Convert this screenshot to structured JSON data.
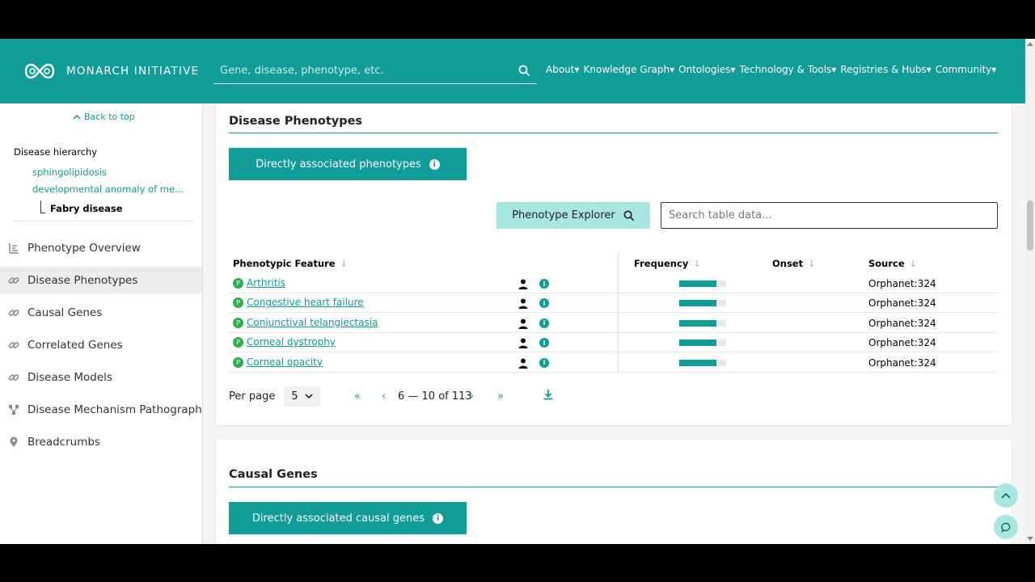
{
  "header": {
    "brand": "MONARCH INITIATIVE",
    "search_placeholder": "Gene, disease, phenotype, etc.",
    "nav": [
      "About▾",
      "Knowledge Graph▾",
      "Ontologies▾",
      "Technology & Tools▾",
      "Registries & Hubs▾",
      "Community▾"
    ]
  },
  "sidebar": {
    "back_to_top": "Back to top",
    "hierarchy_title": "Disease hierarchy",
    "hierarchy_links": [
      "sphingolipidosis",
      "developmental anomaly of me..."
    ],
    "hierarchy_current": "Fabry disease",
    "items": [
      {
        "label": "Phenotype Overview",
        "icon": "chart-icon"
      },
      {
        "label": "Disease Phenotypes",
        "icon": "link-icon"
      },
      {
        "label": "Causal Genes",
        "icon": "link-icon"
      },
      {
        "label": "Correlated Genes",
        "icon": "link-icon"
      },
      {
        "label": "Disease Models",
        "icon": "link-icon"
      },
      {
        "label": "Disease Mechanism Pathograph",
        "icon": "graph-icon"
      },
      {
        "label": "Breadcrumbs",
        "icon": "pin-icon"
      }
    ],
    "active_index": 1
  },
  "phenotypes": {
    "title": "Disease Phenotypes",
    "tab_label": "Directly associated phenotypes",
    "explorer_label": "Phenotype Explorer",
    "table_search_placeholder": "Search table data...",
    "columns": [
      "Phenotypic Feature",
      "Frequency",
      "Onset",
      "Source"
    ],
    "rows": [
      {
        "feature": "Arthritis",
        "frequency": 0.8,
        "source": "Orphanet:324"
      },
      {
        "feature": "Congestive heart failure",
        "frequency": 0.8,
        "source": "Orphanet:324"
      },
      {
        "feature": "Conjunctival telangiectasia",
        "frequency": 0.8,
        "source": "Orphanet:324"
      },
      {
        "feature": "Corneal dystrophy",
        "frequency": 0.8,
        "source": "Orphanet:324"
      },
      {
        "feature": "Corneal opacity",
        "frequency": 0.8,
        "source": "Orphanet:324"
      }
    ],
    "per_page_label": "Per page",
    "per_page_value": "5",
    "range": "6 — 10 of 113"
  },
  "causal": {
    "title": "Causal Genes",
    "tab_label": "Directly associated causal genes"
  },
  "colors": {
    "brand": "#109c97",
    "accent_light": "#a8e6e2",
    "phenotype_badge": "#2fb04a"
  }
}
